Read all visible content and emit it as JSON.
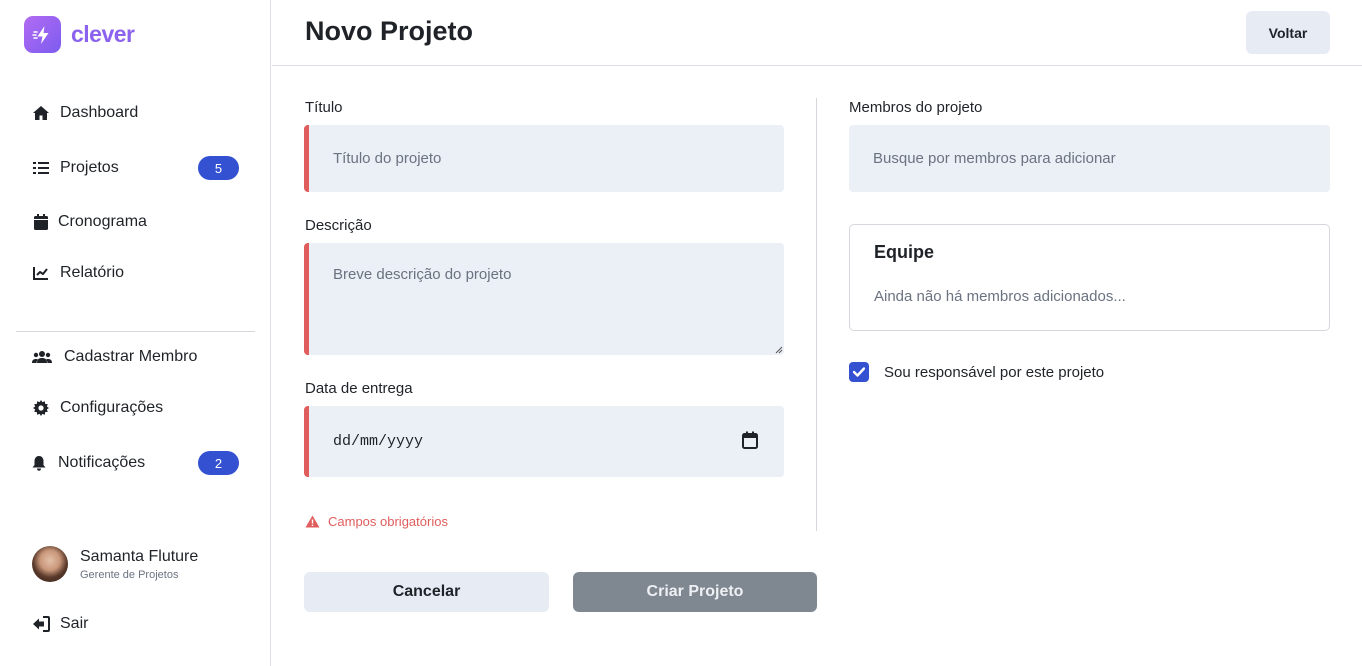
{
  "app": {
    "name": "clever",
    "brand_color": "#8b63ee",
    "accent_color": "#3451d1",
    "error_color": "#e05d5d"
  },
  "sidebar": {
    "nav": [
      {
        "label": "Dashboard",
        "icon": "home-icon"
      },
      {
        "label": "Projetos",
        "icon": "list-icon",
        "badge": "5"
      },
      {
        "label": "Cronograma",
        "icon": "calendar-icon"
      },
      {
        "label": "Relatório",
        "icon": "chart-line-icon"
      }
    ],
    "secondary": [
      {
        "label": "Cadastrar Membro",
        "icon": "users-icon"
      },
      {
        "label": "Configurações",
        "icon": "gear-icon"
      },
      {
        "label": "Notificações",
        "icon": "bell-icon",
        "badge": "2"
      }
    ],
    "user": {
      "name": "Samanta Fluture",
      "role": "Gerente de Projetos"
    },
    "logout": {
      "label": "Sair",
      "icon": "sign-out-icon"
    }
  },
  "header": {
    "title": "Novo Projeto",
    "back_label": "Voltar"
  },
  "form": {
    "title": {
      "label": "Título",
      "placeholder": "Título do projeto",
      "value": ""
    },
    "description": {
      "label": "Descrição",
      "placeholder": "Breve descrição do projeto",
      "value": ""
    },
    "due_date": {
      "label": "Data de entrega",
      "value": "dd/mm/yyyy"
    },
    "error": "Campos obrigatórios",
    "cancel_label": "Cancelar",
    "submit_label": "Criar Projeto"
  },
  "members": {
    "label": "Membros do projeto",
    "search_placeholder": "Busque por membros para adicionar",
    "team_title": "Equipe",
    "team_empty": "Ainda não há membros adicionados...",
    "responsible_label": "Sou responsável por este projeto",
    "responsible_checked": true
  }
}
